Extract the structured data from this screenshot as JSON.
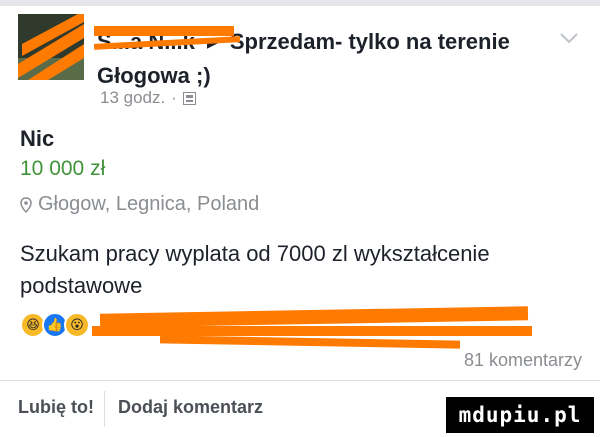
{
  "post": {
    "author": "S...a N...k",
    "arrow": "▶",
    "group": "Sprzedam- tylko na terenie Głogowa ;)",
    "time": "13 godz.",
    "privacy_icon": "group-icon"
  },
  "item": {
    "title": "Nic",
    "price": "10 000 zł",
    "location_icon": "location-pin-icon",
    "location": "Głogow, Legnica, Poland",
    "description": "Szukam pracy wyplata od 7000 zl wykształcenie podstawowe"
  },
  "engagement": {
    "reaction_icons": [
      "haha-icon",
      "like-icon",
      "wow-icon"
    ],
    "comments": "81 komentarzy"
  },
  "actions": {
    "like_label": "Lubię to!",
    "comment_label": "Dodaj komentarz"
  },
  "watermark": "mdupiu.pl",
  "colors": {
    "price_green": "#40933a",
    "like_blue": "#1877f2",
    "redaction_orange": "#ff7a00",
    "muted_text": "#8a8d91"
  }
}
